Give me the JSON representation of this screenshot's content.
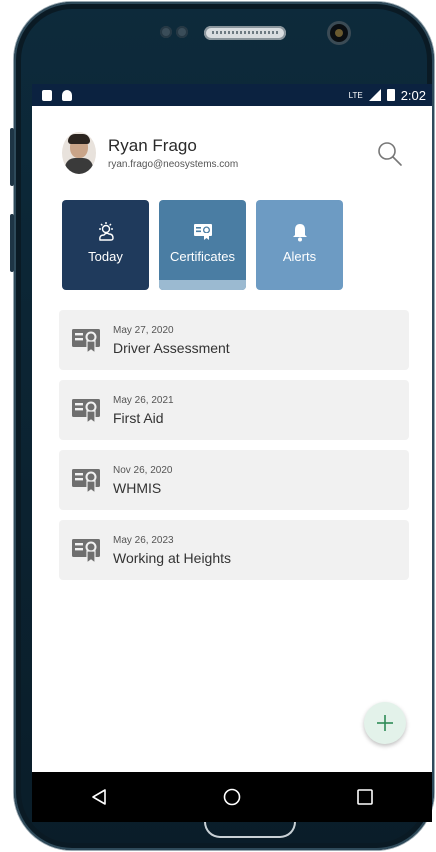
{
  "status_bar": {
    "network": "LTE",
    "time": "2:02"
  },
  "profile": {
    "name": "Ryan Frago",
    "email": "ryan.frago@neosystems.com"
  },
  "tiles": [
    {
      "label": "Today",
      "icon": "weather-icon"
    },
    {
      "label": "Certificates",
      "icon": "certificate-icon",
      "selected": true
    },
    {
      "label": "Alerts",
      "icon": "bell-icon"
    }
  ],
  "certificates": [
    {
      "date": "May 27, 2020",
      "name": "Driver Assessment"
    },
    {
      "date": "May 26, 2021",
      "name": "First Aid"
    },
    {
      "date": "Nov 26, 2020",
      "name": "WHMIS"
    },
    {
      "date": "May 26, 2023",
      "name": "Working at Heights"
    }
  ],
  "colors": {
    "status_bar": "#0b2240",
    "tile_today": "#1f3a5c",
    "tile_certificates": "#4a7da3",
    "tile_alerts": "#6d9bc3",
    "card_bg": "#f1f1f1",
    "fab_bg": "#e3f2ea",
    "fab_plus": "#2e8b57"
  }
}
